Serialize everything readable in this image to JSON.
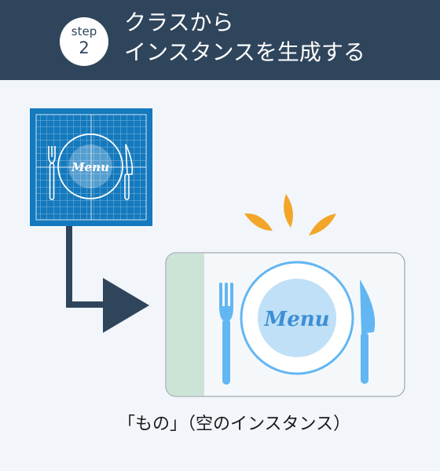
{
  "header": {
    "step_word": "step",
    "step_number": "2",
    "title_line1": "クラスから",
    "title_line2": "インスタンスを生成する"
  },
  "blueprint": {
    "plate_text": "Menu"
  },
  "instance": {
    "plate_text": "Menu"
  },
  "caption": "「もの」（空のインスタンス）",
  "colors": {
    "header_bg": "#2f455c",
    "page_bg": "#f2f6fb",
    "blueprint_bg": "#1479bd",
    "arrow": "#2f455c",
    "instance_accent": "#62b6f2",
    "plate_fill": "#bfe0f7",
    "spark": "#f3a52a",
    "card_stripe": "#cce4d6"
  }
}
